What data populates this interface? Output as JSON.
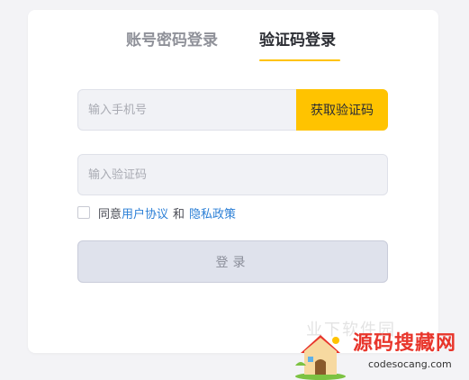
{
  "login": {
    "tabs": [
      "账号密码登录",
      "验证码登录"
    ],
    "phone_placeholder": "输入手机号",
    "get_code_label": "获取验证码",
    "code_placeholder": "输入验证码",
    "agree_prefix": "同意",
    "user_agreement": "用户协议",
    "and": "和",
    "privacy_policy": "隐私政策",
    "login_label": "登录"
  },
  "watermark": {
    "faint_text": "业下软件园",
    "site_name": "源码搜藏网",
    "url": "codesocang.com"
  },
  "colors": {
    "accent": "#ffc300",
    "link": "#2b7fd6",
    "watermark_red": "#e8352b"
  }
}
